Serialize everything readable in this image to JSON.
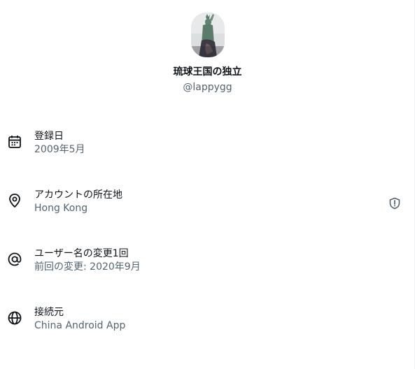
{
  "profile": {
    "display_name": "琉球王国の独立",
    "handle": "@lappygg"
  },
  "rows": [
    {
      "label": "登録日",
      "value": "2009年5月",
      "icon": "calendar-icon"
    },
    {
      "label": "アカウントの所在地",
      "value": "Hong Kong",
      "icon": "location-pin-icon",
      "badge_icon": "shield-alert-icon"
    },
    {
      "label": "ユーザー名の変更1回",
      "value": "前回の変更: 2020年9月",
      "icon": "at-sign-icon"
    },
    {
      "label": "接続元",
      "value": "China Android App",
      "icon": "globe-icon"
    }
  ],
  "colors": {
    "text_primary": "#0f1419",
    "text_secondary": "#536471",
    "background": "#ffffff"
  }
}
